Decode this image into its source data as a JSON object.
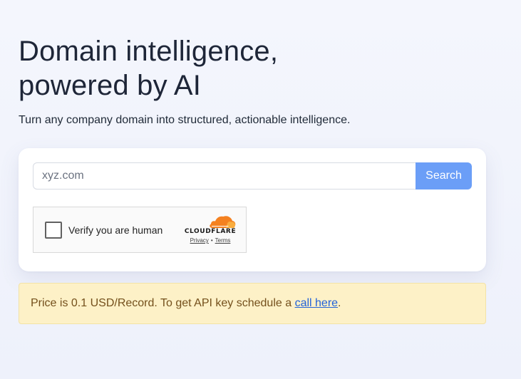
{
  "hero": {
    "headline_line1": "Domain intelligence,",
    "headline_line2": "powered by AI",
    "subtitle": "Turn any company domain into structured, actionable intelligence."
  },
  "search": {
    "placeholder": "xyz.com",
    "value": "",
    "button_label": "Search"
  },
  "captcha": {
    "label": "Verify you are human",
    "checked": false,
    "provider": "CLOUDFLARE",
    "privacy_link": "Privacy",
    "separator": "•",
    "terms_link": "Terms",
    "icon": "cloudflare-cloud-icon"
  },
  "notice": {
    "text_before": "Price is 0.1 USD/Record. To get API key schedule a ",
    "link_text": "call here",
    "text_after": "."
  },
  "colors": {
    "accent": "#6b9ef7",
    "notice_bg": "#fdf1c7",
    "notice_text": "#74501c",
    "link": "#2363d9",
    "cloudflare_orange": "#f48120"
  }
}
